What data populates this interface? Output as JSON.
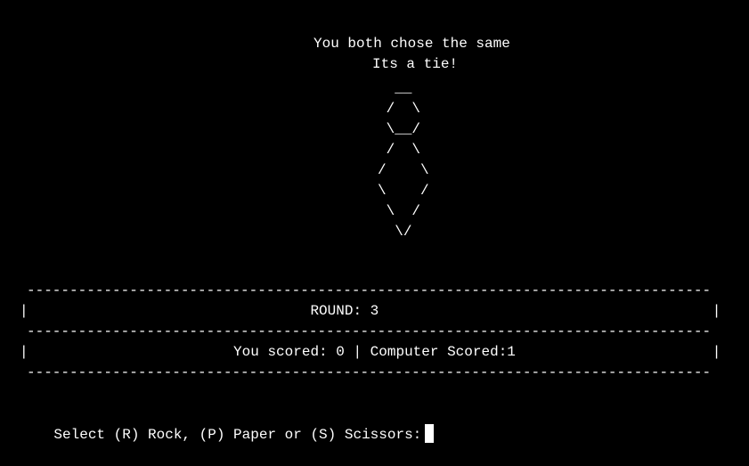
{
  "result": {
    "line1": "You both chose the same",
    "line2": "Its a tie!"
  },
  "art": {
    "icon": "ascii-tie",
    "text": "       __\n      /  \\\n      \\__/\n      /  \\\n     /    \\\n     \\    /\n      \\  /\n       \\/"
  },
  "scoreboard": {
    "border": "--------------------------------------------------------------------------------",
    "round_row": "|                                 ROUND: 3                                       |",
    "score_row": "|                        You scored: 0 | Computer Scored:1                       |"
  },
  "prompt": {
    "text": "Select (R) Rock, (P) Paper or (S) Scissors:"
  },
  "colors": {
    "background": "#000000",
    "foreground": "#ffffff"
  }
}
